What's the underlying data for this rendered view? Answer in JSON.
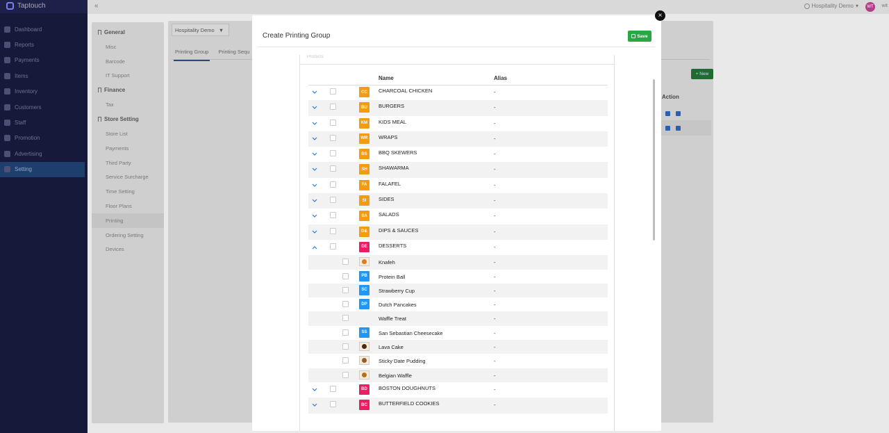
{
  "app": {
    "brand": "Taptouch",
    "collapse_icon": "«"
  },
  "nav": {
    "items": [
      {
        "label": "Dashboard",
        "icon": "dashboard-icon"
      },
      {
        "label": "Reports",
        "icon": "reports-icon"
      },
      {
        "label": "Payments",
        "icon": "payments-icon"
      },
      {
        "label": "Items",
        "icon": "items-icon"
      },
      {
        "label": "Inventory",
        "icon": "inventory-icon"
      },
      {
        "label": "Customers",
        "icon": "customers-icon"
      },
      {
        "label": "Staff",
        "icon": "staff-icon"
      },
      {
        "label": "Promotion",
        "icon": "promotion-icon"
      },
      {
        "label": "Advertising",
        "icon": "advertising-icon"
      },
      {
        "label": "Setting",
        "icon": "setting-icon"
      }
    ],
    "active": "Setting"
  },
  "topbar": {
    "venue": "Hospitality Demo",
    "avatar": "WT",
    "user": "wit"
  },
  "settings_panel": {
    "general": {
      "title": "General",
      "items": [
        "Misc",
        "Barcode",
        "IT Support"
      ]
    },
    "finance": {
      "title": "Finance",
      "items": [
        "Tax"
      ]
    },
    "store": {
      "title": "Store Setting",
      "items": [
        "Store List",
        "Payments",
        "Third Party",
        "Service Surcharge",
        "Time Setting",
        "Floor Plans",
        "Printing",
        "Ordering Setting",
        "Devices"
      ]
    },
    "selected": "Printing"
  },
  "content": {
    "venue_select": "Hospitality Demo",
    "tabs": [
      "Printing Group",
      "Printing Sequ"
    ],
    "new_button": "+ New",
    "action_header": "Action"
  },
  "modal": {
    "title": "Create Printing Group",
    "save_label": "Save",
    "close_label": "×",
    "section_label": "Products",
    "columns": {
      "name": "Name",
      "alias": "Alias"
    },
    "categories": [
      {
        "code": "CC",
        "name": "CHARCOAL CHICKEN",
        "alias": "-",
        "color": "#f39c12",
        "expanded": false
      },
      {
        "code": "BU",
        "name": "BURGERS",
        "alias": "-",
        "color": "#f39c12",
        "expanded": false
      },
      {
        "code": "KM",
        "name": "KIDS MEAL",
        "alias": "-",
        "color": "#f39c12",
        "expanded": false
      },
      {
        "code": "WR",
        "name": "WRAPS",
        "alias": "-",
        "color": "#f39c12",
        "expanded": false
      },
      {
        "code": "BS",
        "name": "BBQ SKEWERS",
        "alias": "-",
        "color": "#f39c12",
        "expanded": false
      },
      {
        "code": "SH",
        "name": "SHAWARMA",
        "alias": "-",
        "color": "#f39c12",
        "expanded": false
      },
      {
        "code": "FA",
        "name": "FALAFEL",
        "alias": "-",
        "color": "#f39c12",
        "expanded": false
      },
      {
        "code": "SI",
        "name": "SIDES",
        "alias": "-",
        "color": "#f39c12",
        "expanded": false
      },
      {
        "code": "SA",
        "name": "SALADS",
        "alias": "-",
        "color": "#f39c12",
        "expanded": false
      },
      {
        "code": "D&",
        "name": "DIPS & SAUCES",
        "alias": "-",
        "color": "#f39c12",
        "expanded": false
      },
      {
        "code": "DE",
        "name": "DESSERTS",
        "alias": "-",
        "color": "#e91e63",
        "expanded": true,
        "children": [
          {
            "name": "Knafeh",
            "alias": "-",
            "thumb": "dessert-image",
            "color": "#e07b1f"
          },
          {
            "name": "Protein Ball",
            "alias": "-",
            "code": "PB",
            "color": "#2196f3"
          },
          {
            "name": "Strawberry Cup",
            "alias": "-",
            "code": "SC",
            "color": "#2196f3"
          },
          {
            "name": "Dutch Pancakes",
            "alias": "-",
            "code": "DP",
            "color": "#2196f3"
          },
          {
            "name": "Waffle Treat",
            "alias": "-"
          },
          {
            "name": "San Sebastian Cheesecake",
            "alias": "-",
            "code": "SS",
            "color": "#2196f3"
          },
          {
            "name": "Lava Cake",
            "alias": "-",
            "thumb": "dessert-image",
            "color": "#4a2a17"
          },
          {
            "name": "Sticky Date Pudding",
            "alias": "-",
            "thumb": "dessert-image",
            "color": "#9a5a2c"
          },
          {
            "name": "Belgian Waffle",
            "alias": "-",
            "thumb": "dessert-image",
            "color": "#b5701f"
          }
        ]
      },
      {
        "code": "BD",
        "name": "BOSTON DOUGHNUTS",
        "alias": "-",
        "color": "#e91e63",
        "expanded": false
      },
      {
        "code": "BC",
        "name": "BUTTERFIELD COOKIES",
        "alias": "-",
        "color": "#e91e63",
        "expanded": false
      }
    ]
  }
}
